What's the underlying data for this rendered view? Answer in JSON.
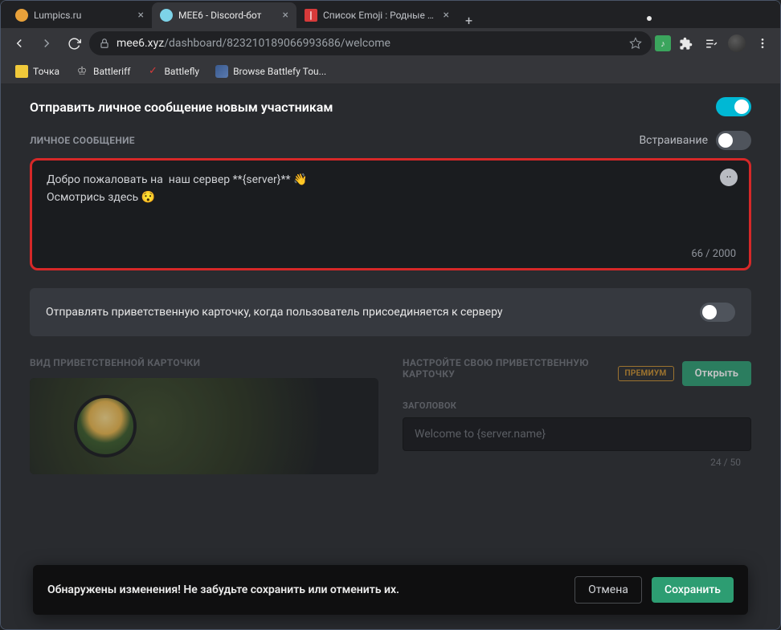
{
  "window": {
    "tabs": [
      {
        "title": "Lumpics.ru",
        "favicon_color": "#e8a13a",
        "active": false
      },
      {
        "title": "MEE6 - Discord-бот",
        "favicon_color": "#7dd3e8",
        "active": true
      },
      {
        "title": "Список Emoji : Родные сим",
        "favicon_color": "#d63a3a",
        "active": false
      }
    ],
    "url_domain": "mee6.xyz",
    "url_path": "/dashboard/823210189066993686/welcome"
  },
  "bookmarks": [
    {
      "label": "Точка",
      "color": "#f0c93a"
    },
    {
      "label": "Battleriff",
      "color": "transparent"
    },
    {
      "label": "Battlefly",
      "color": "#d63a3a"
    },
    {
      "label": "Browse Battlefy Tou...",
      "color": "#3a5a8f"
    }
  ],
  "page": {
    "section_title": "Отправить личное сообщение новым участникам",
    "section_toggle_on": true,
    "private_message_label": "ЛИЧНОЕ СООБЩЕНИЕ",
    "embed_label": "Встраивание",
    "embed_toggle_on": false,
    "message_text": "Добро пожаловать на  наш сервер **{server}** 👋\nОсмотрись здесь 😯",
    "char_counter": "66 / 2000",
    "card_send_label": "Отправлять приветственную карточку, когда пользователь присоединяется к серверу",
    "card_toggle_on": false,
    "preview_heading": "ВИД ПРИВЕТСТВЕННОЙ КАРТОЧКИ",
    "customize_heading": "НАСТРОЙТЕ СВОЮ ПРИВЕТСТВЕННУЮ КАРТОЧКУ",
    "premium_badge": "ПРЕМИУМ",
    "open_button": "Открыть",
    "title_field_label": "ЗАГОЛОВОК",
    "title_field_value": "Welcome to {server.name}",
    "title_field_counter": "24 / 50",
    "save_bar_text": "Обнаружены изменения! Не забудьте сохранить или отменить их.",
    "cancel_button": "Отмена",
    "save_button": "Сохранить"
  }
}
